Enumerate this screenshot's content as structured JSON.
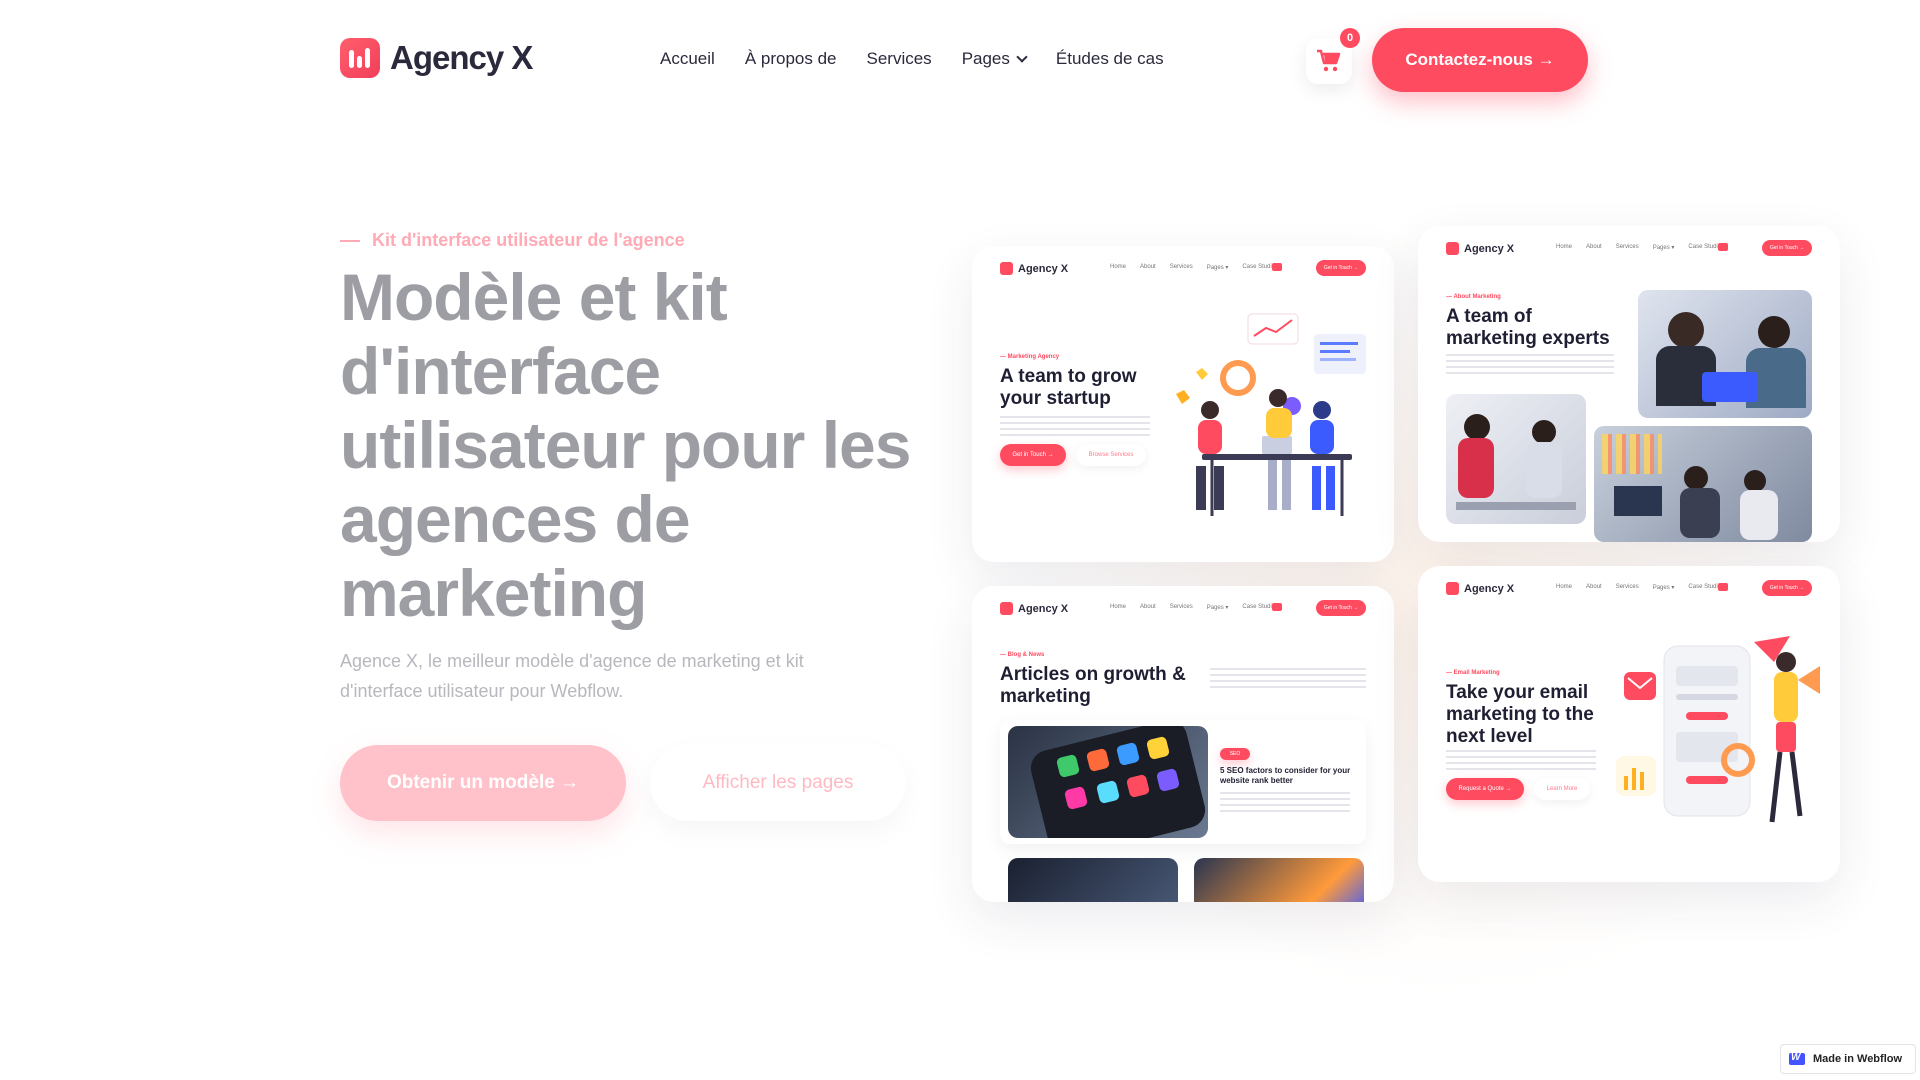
{
  "header": {
    "logo_text": "Agency X",
    "nav": [
      "Accueil",
      "À propos de",
      "Services",
      "Pages",
      "Études de cas"
    ],
    "cart_count": "0",
    "contact_label": "Contactez-nous →"
  },
  "hero": {
    "eyebrow": "Kit d'interface utilisateur de l'agence",
    "title": "Modèle et kit d'interface utilisateur pour les agences de marketing",
    "subtitle": "Agence X, le meilleur modèle d'agence de marketing et kit d'interface utilisateur pour Webflow.",
    "primary_btn": "Obtenir un modèle →",
    "secondary_btn": "Afficher les pages"
  },
  "previews": {
    "mini_logo": "Agency X",
    "mini_nav": [
      "Home",
      "About",
      "Services",
      "Pages ▾",
      "Case Studies"
    ],
    "mini_cta": "Get in Touch →",
    "card1": {
      "tag": "— Marketing Agency",
      "title": "A team to grow your startup",
      "btn1": "Get in Touch →",
      "btn2": "Browse Services"
    },
    "card2": {
      "tag": "— About Marketing",
      "title": "A team of marketing experts"
    },
    "card3": {
      "tag": "— Blog & News",
      "title": "Articles on growth & marketing",
      "badge": "SEO",
      "post_title": "5 SEO factors to consider for your website rank better"
    },
    "card4": {
      "tag": "— Email Marketing",
      "title": "Take your email marketing to the next level",
      "btn1": "Request a Quote →",
      "btn2": "Learn More"
    }
  },
  "badge": {
    "label": "Made in Webflow"
  },
  "colors": {
    "accent": "#ff4b60",
    "accent_light": "#ffc2ca",
    "title_gray": "#9d9da4"
  }
}
